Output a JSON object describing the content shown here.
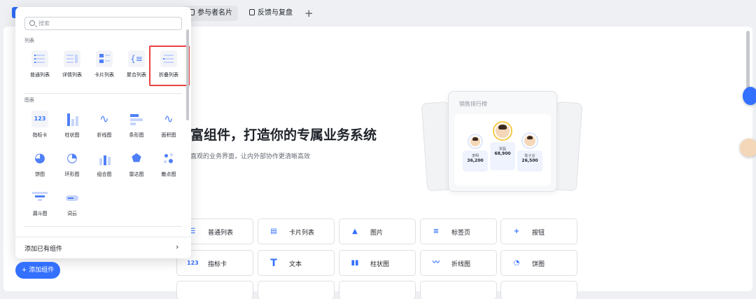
{
  "tabs": [
    {
      "label": "参与者名片",
      "active": true
    },
    {
      "label": "反馈与复盘",
      "active": false
    }
  ],
  "tab_add_label": "+",
  "hero": {
    "title": "富组件，打造你的专属业务系统",
    "subtitle": "直观的业务界面，让内外部协作更清晰高效"
  },
  "preview_card": {
    "title": "销售排行榜",
    "podium": [
      {
        "name": "李明",
        "value": "36,200",
        "rank": 2
      },
      {
        "name": "张磊",
        "value": "68,900",
        "rank": 1
      },
      {
        "name": "陈子言",
        "value": "26,500",
        "rank": 3
      }
    ]
  },
  "component_grid": [
    {
      "label": "普通列表",
      "icon": "list-icon"
    },
    {
      "label": "卡片列表",
      "icon": "card-list-icon"
    },
    {
      "label": "图片",
      "icon": "image-icon"
    },
    {
      "label": "标签页",
      "icon": "tabs-icon"
    },
    {
      "label": "按钮",
      "icon": "plus-icon"
    },
    {
      "label": "指标卡",
      "icon": "metric-icon",
      "glyph": "123"
    },
    {
      "label": "文本",
      "icon": "text-icon",
      "glyph": "T"
    },
    {
      "label": "柱状图",
      "icon": "bar-chart-icon"
    },
    {
      "label": "折线图",
      "icon": "line-chart-icon"
    },
    {
      "label": "饼图",
      "icon": "pie-chart-icon"
    }
  ],
  "panel": {
    "search_placeholder": "搜索",
    "sections": [
      {
        "title": "列表",
        "items": [
          {
            "label": "普通列表",
            "icon": "plain-list-icon"
          },
          {
            "label": "详情列表",
            "icon": "detail-list-icon"
          },
          {
            "label": "卡片列表",
            "icon": "card-list-icon"
          },
          {
            "label": "聚合列表",
            "icon": "aggregate-list-icon"
          },
          {
            "label": "折叠列表",
            "icon": "collapse-list-icon",
            "highlighted": true
          }
        ]
      },
      {
        "title": "图表",
        "items": [
          {
            "label": "指标卡",
            "icon": "metric-card-icon",
            "glyph": "123"
          },
          {
            "label": "柱状图",
            "icon": "bar-chart-icon"
          },
          {
            "label": "折线图",
            "icon": "line-chart-icon"
          },
          {
            "label": "条形图",
            "icon": "hbar-chart-icon"
          },
          {
            "label": "面积图",
            "icon": "area-chart-icon"
          },
          {
            "label": "饼图",
            "icon": "pie-chart-icon"
          },
          {
            "label": "环形图",
            "icon": "donut-chart-icon"
          },
          {
            "label": "组合图",
            "icon": "combo-chart-icon"
          },
          {
            "label": "雷达图",
            "icon": "radar-chart-icon"
          },
          {
            "label": "散点图",
            "icon": "scatter-chart-icon"
          },
          {
            "label": "漏斗图",
            "icon": "funnel-chart-icon"
          },
          {
            "label": "词云",
            "icon": "word-cloud-icon"
          }
        ]
      }
    ],
    "footer_label": "添加已有组件",
    "footer_arrow": "›"
  },
  "add_button_label": "+ 添加组件",
  "colors": {
    "accent": "#3370ff",
    "highlight": "#e94242"
  }
}
